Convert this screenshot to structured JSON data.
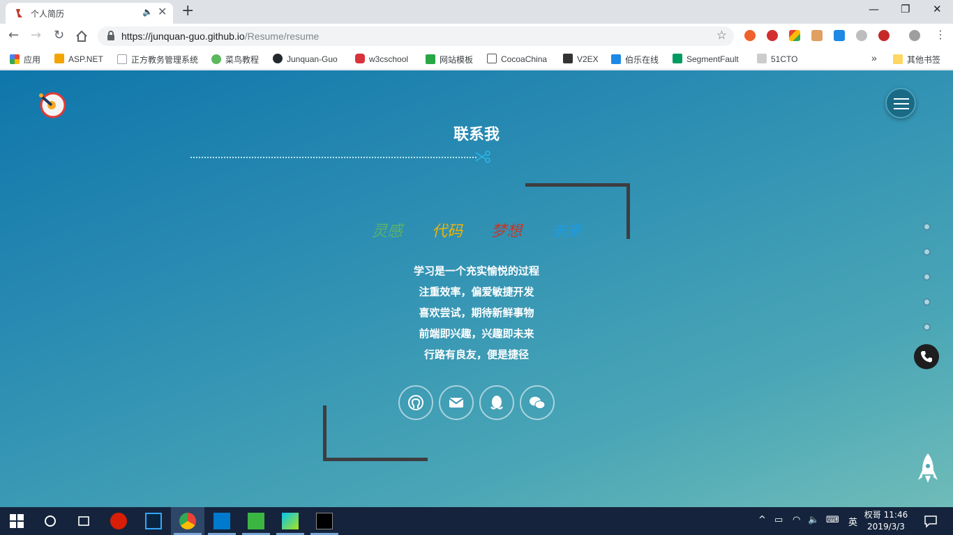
{
  "browser": {
    "tab": {
      "title": "个人简历"
    },
    "url": {
      "base": "https://junquan-guo.github.io",
      "path": "/Resume/resume"
    },
    "bookmarks": [
      {
        "label": "应用",
        "color": "#e94335"
      },
      {
        "label": "ASP.NET",
        "color": "#f4a400"
      },
      {
        "label": "正方教务管理系统",
        "color": "#9aa0a6"
      },
      {
        "label": "菜鸟教程",
        "color": "#5cb85c"
      },
      {
        "label": "Junquan-Guo",
        "color": "#24292e"
      },
      {
        "label": "w3cschool",
        "color": "#d9323a"
      },
      {
        "label": "网站模板",
        "color": "#28a745"
      },
      {
        "label": "CocoaChina",
        "color": "#555555"
      },
      {
        "label": "V2EX",
        "color": "#333333"
      },
      {
        "label": "伯乐在线",
        "color": "#1e88e5"
      },
      {
        "label": "SegmentFault",
        "color": "#009a61"
      },
      {
        "label": "51CTO",
        "color": "#888888"
      }
    ],
    "bookmarks_overflow": "»",
    "other_bookmarks": "其他书签"
  },
  "page": {
    "section_title": "联系我",
    "keywords": [
      {
        "text": "灵感",
        "color": "#5ab36a"
      },
      {
        "text": "代码",
        "color": "#f0b400"
      },
      {
        "text": "梦想",
        "color": "#c0392b"
      },
      {
        "text": "未来",
        "color": "#1e9be0"
      }
    ],
    "poem": [
      "学习是一个充实愉悦的过程",
      "注重效率，偏爱敏捷开发",
      "喜欢尝试，期待新鲜事物",
      "前端即兴趣，兴趣即未来",
      "行路有良友，便是捷径"
    ],
    "social": [
      "github-icon",
      "mail-icon",
      "qq-icon",
      "wechat-icon"
    ]
  },
  "taskbar": {
    "ime": "英",
    "user": "权哥",
    "time": "11:46",
    "date": "2019/3/3"
  }
}
